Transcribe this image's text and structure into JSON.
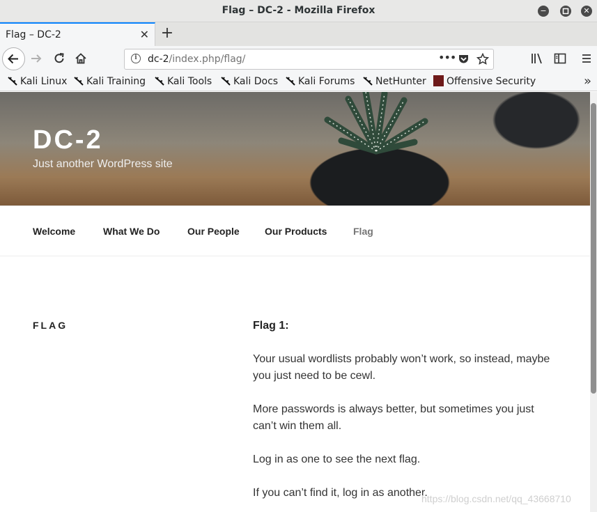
{
  "window": {
    "title": "Flag – DC-2 - Mozilla Firefox"
  },
  "tab": {
    "label": "Flag – DC-2",
    "close": "✕"
  },
  "navbar": {
    "url_host": "dc-2",
    "url_path": "/index.php/flag/",
    "more": "•••"
  },
  "bookmarks": [
    {
      "label": "Kali Linux"
    },
    {
      "label": "Kali Training"
    },
    {
      "label": "Kali Tools"
    },
    {
      "label": "Kali Docs"
    },
    {
      "label": "Kali Forums"
    },
    {
      "label": "NetHunter"
    },
    {
      "label": "Offensive Security"
    }
  ],
  "site": {
    "title": "DC-2",
    "description": "Just another WordPress site"
  },
  "menu": [
    {
      "label": "Welcome"
    },
    {
      "label": "What We Do"
    },
    {
      "label": "Our People"
    },
    {
      "label": "Our Products"
    },
    {
      "label": "Flag"
    }
  ],
  "page": {
    "heading": "FLAG",
    "flag_title": "Flag 1:",
    "paragraphs": [
      "Your usual wordlists probably won’t work, so instead, maybe you just need to be cewl.",
      "More passwords is always better, but sometimes you just can’t win them all.",
      "Log in as one to see the next flag.",
      "If you can’t find it, log in as another."
    ]
  },
  "watermark": "https://blog.csdn.net/qq_43668710",
  "colors": {
    "tab_accent": "#0a84ff",
    "titlebar": "#e8e8e7",
    "menu_current": "#767676"
  }
}
